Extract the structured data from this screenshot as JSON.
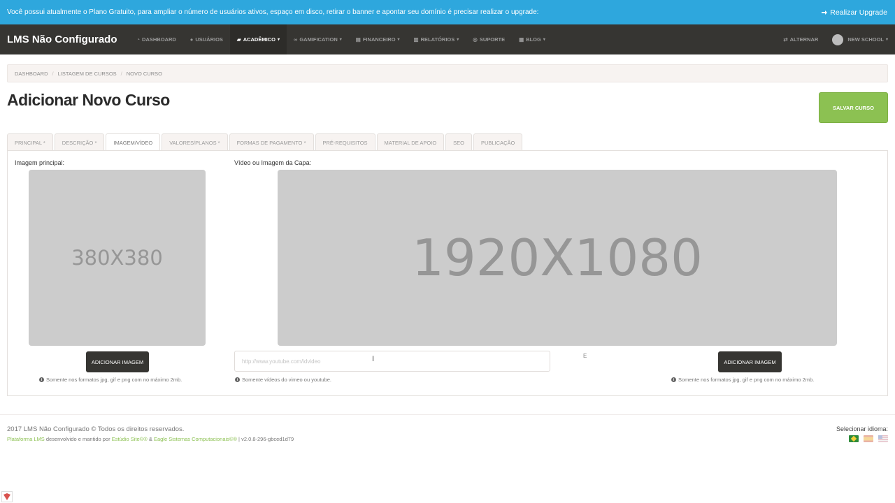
{
  "banner": {
    "message": "Você possui atualmente o Plano Gratuito, para ampliar o número de usuários ativos, espaço em disco, retirar o banner e apontar seu domínio é precisar realizar o upgrade:",
    "upgrade_label": "Realizar Upgrade",
    "upgrade_icon": "arrow-right-icon"
  },
  "navbar": {
    "brand": "LMS Não Configurado",
    "items": [
      {
        "label": "DASHBOARD",
        "icon": "dashboard-icon",
        "caret": ""
      },
      {
        "label": "USUÁRIOS",
        "icon": "user-icon",
        "caret": ""
      },
      {
        "label": "ACADÊMICO",
        "icon": "graduation-icon",
        "caret": "▾"
      },
      {
        "label": "GAMIFICATION",
        "icon": "gamepad-icon",
        "caret": "▾"
      },
      {
        "label": "FINANCEIRO",
        "icon": "bank-icon",
        "caret": "▾"
      },
      {
        "label": "RELATÓRIOS",
        "icon": "chart-icon",
        "caret": "▾"
      },
      {
        "label": "SUPORTE",
        "icon": "lifebuoy-icon",
        "caret": ""
      },
      {
        "label": "BLOG",
        "icon": "newspaper-icon",
        "caret": "▾"
      }
    ],
    "alternar_label": "ALTERNAR",
    "school_label": "NEW SCHOOL",
    "caret": "▾"
  },
  "breadcrumb": {
    "items": [
      "DASHBOARD",
      "LISTAGEM DE CURSOS",
      "NOVO CURSO"
    ],
    "separator": "/"
  },
  "page": {
    "title": "Adicionar Novo Curso",
    "save_label": "SALVAR CURSO"
  },
  "tabs": [
    {
      "label": "PRINCIPAL *"
    },
    {
      "label": "DESCRIÇÃO *"
    },
    {
      "label": "IMAGEM/VÍDEO"
    },
    {
      "label": "VALORES/PLANOS *"
    },
    {
      "label": "FORMAS DE PAGAMENTO *"
    },
    {
      "label": "PRÉ-REQUISITOS"
    },
    {
      "label": "MATERIAL DE APOIO"
    },
    {
      "label": "SEO"
    },
    {
      "label": "PUBLICAÇÃO"
    }
  ],
  "main_image": {
    "label": "Imagem principal:",
    "placeholder_text": "380X380",
    "button_label": "ADICIONAR IMAGEM",
    "hint": "Somente nos formatos jpg, gif e png com no máximo 2mb."
  },
  "cover": {
    "label": "Vídeo ou Imagem da Capa:",
    "placeholder_text": "1920X1080",
    "video_placeholder": "http://www.youtube.com/idvideo",
    "video_hint": "Somente vídeos do vimeo ou youtube.",
    "or_text": "E",
    "button_label": "ADICIONAR IMAGEM",
    "hint": "Somente nos formatos jpg, gif e png com no máximo 2mb."
  },
  "footer": {
    "copyright": "2017 LMS Não Configurado © Todos os direitos reservados.",
    "credits_link1": "Plataforma LMS",
    "credits_text1": " desenvolvido e mantido por ",
    "credits_link2": "Estúdio Site©®",
    "credits_text2": " & ",
    "credits_link3": "Eagle Sistemas Computacionais©®",
    "credits_text3": " | v2.0.8-296-gbced1d79",
    "language_label": "Selecionar idioma:",
    "flags": [
      "flag-brazil",
      "flag-spain",
      "flag-usa"
    ]
  },
  "colors": {
    "banner": "#2ea7dd",
    "navbar": "#363532",
    "accent_green": "#8cc152",
    "placeholder_gray": "#cccccc"
  }
}
